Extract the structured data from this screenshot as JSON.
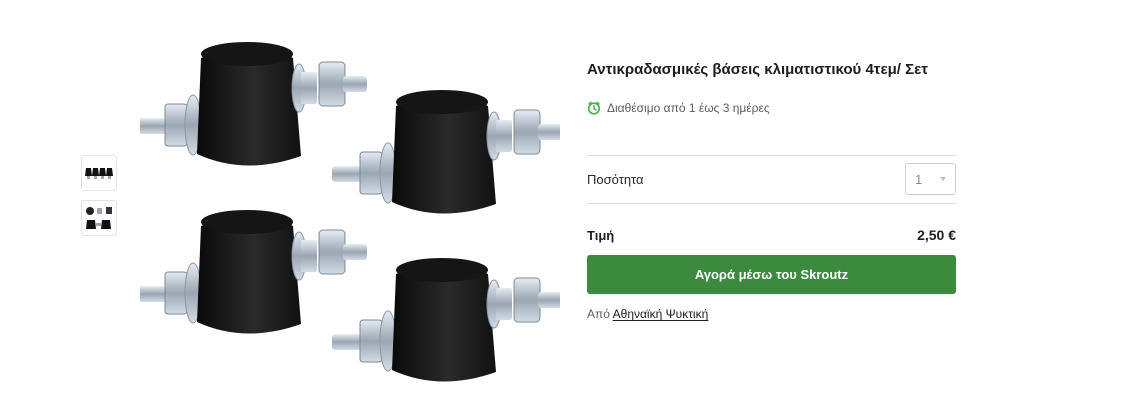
{
  "gallery": {
    "thumbnails": [
      {
        "icon": "four-mounts-thumbnail"
      },
      {
        "icon": "mount-parts-thumbnail"
      }
    ],
    "main_image": {
      "icon": "anti-vibration-mounts-image"
    }
  },
  "product": {
    "title": "Αντικραδασμικές βάσεις κλιματιστικού 4τεμ/ Σετ",
    "availability": "Διαθέσιμο από 1 έως 3 ημέρες",
    "quantity_label": "Ποσότητα",
    "quantity_value": "1",
    "price_label": "Τιμή",
    "price_value": "2,50 €",
    "buy_button": "Αγορά μέσω του Skroutz",
    "seller_prefix": "Από",
    "seller_name": "Αθηναϊκή Ψυκτική"
  },
  "colors": {
    "accent_green": "#3b8a3e",
    "availability_icon": "#4caf50"
  }
}
